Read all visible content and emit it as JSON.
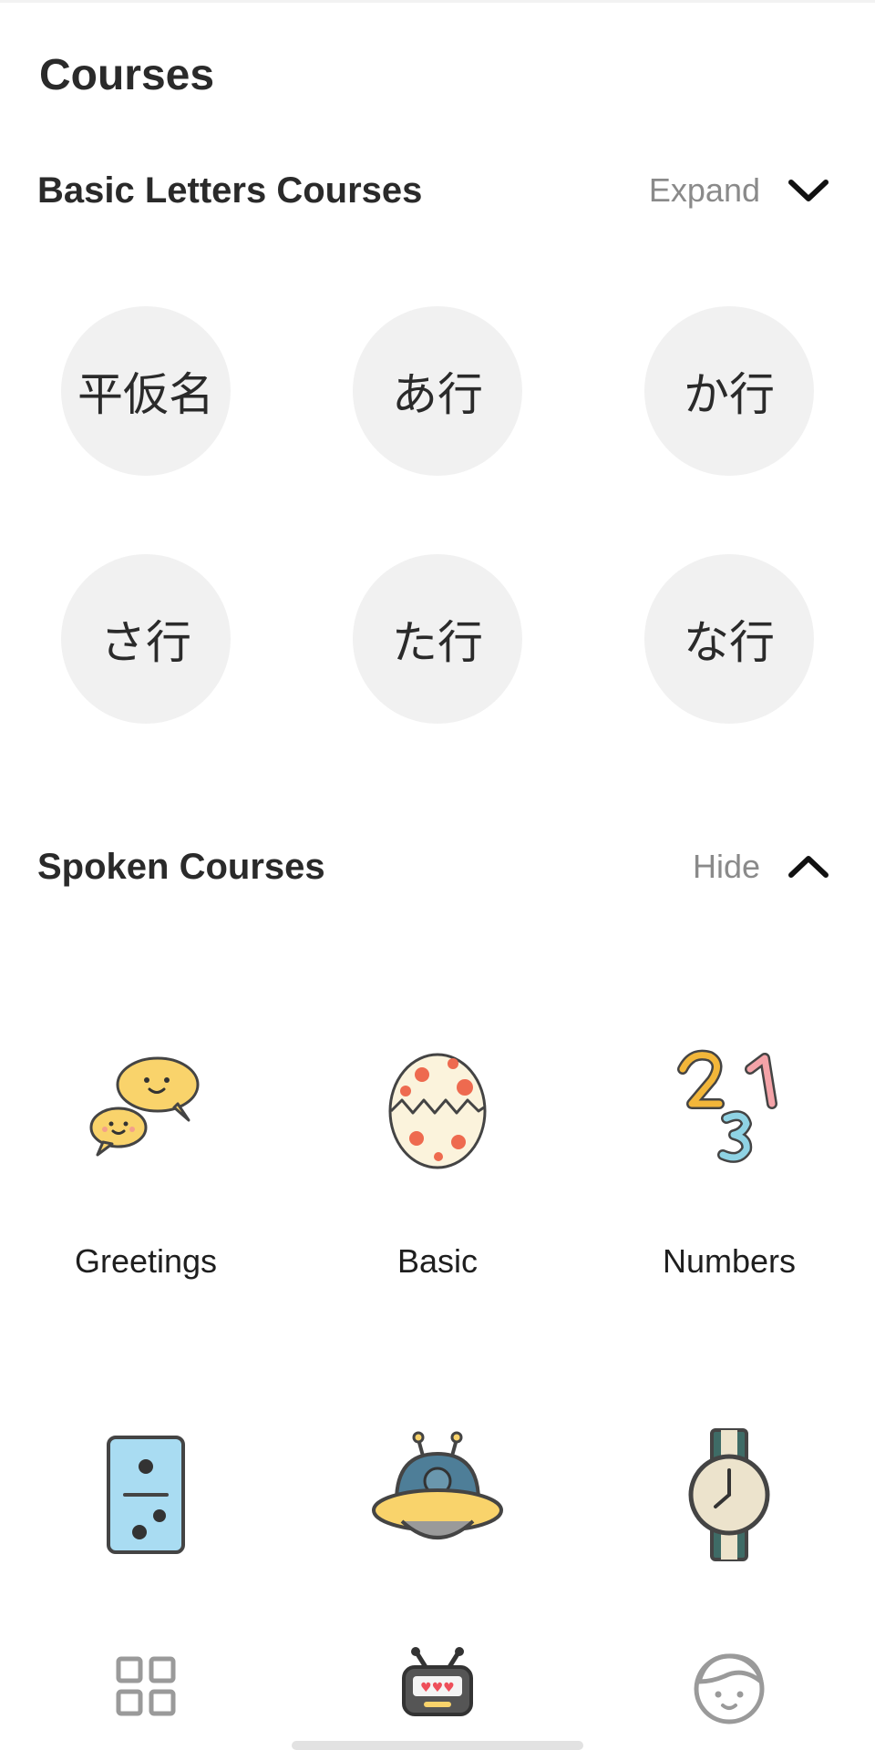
{
  "page": {
    "title": "Courses"
  },
  "sections": {
    "basic_letters": {
      "title": "Basic Letters Courses",
      "toggle_label": "Expand",
      "toggle_icon": "chevron-down-icon",
      "items": [
        "平仮名",
        "あ行",
        "か行",
        "さ行",
        "た行",
        "な行"
      ]
    },
    "spoken": {
      "title": "Spoken Courses",
      "toggle_label": "Hide",
      "toggle_icon": "chevron-up-icon",
      "items": [
        {
          "label": "Greetings",
          "icon": "speech-bubbles-icon"
        },
        {
          "label": "Basic",
          "icon": "cracked-egg-icon"
        },
        {
          "label": "Numbers",
          "icon": "numbers-123-icon"
        },
        {
          "label": "",
          "icon": "domino-icon"
        },
        {
          "label": "",
          "icon": "ufo-icon"
        },
        {
          "label": "",
          "icon": "wristwatch-icon"
        }
      ]
    }
  },
  "bottom_nav": {
    "items": [
      {
        "icon": "grid-icon"
      },
      {
        "icon": "retro-tv-icon"
      },
      {
        "icon": "face-icon"
      }
    ]
  },
  "colors": {
    "circle_bg": "#f1f1f1",
    "muted_text": "#8a8a8a",
    "accent_yellow": "#f9d36b",
    "accent_red": "#ee6a4f",
    "accent_blue": "#4e7e98",
    "light_blue": "#a9dcf2",
    "icon_gray": "#9a9a9a"
  }
}
